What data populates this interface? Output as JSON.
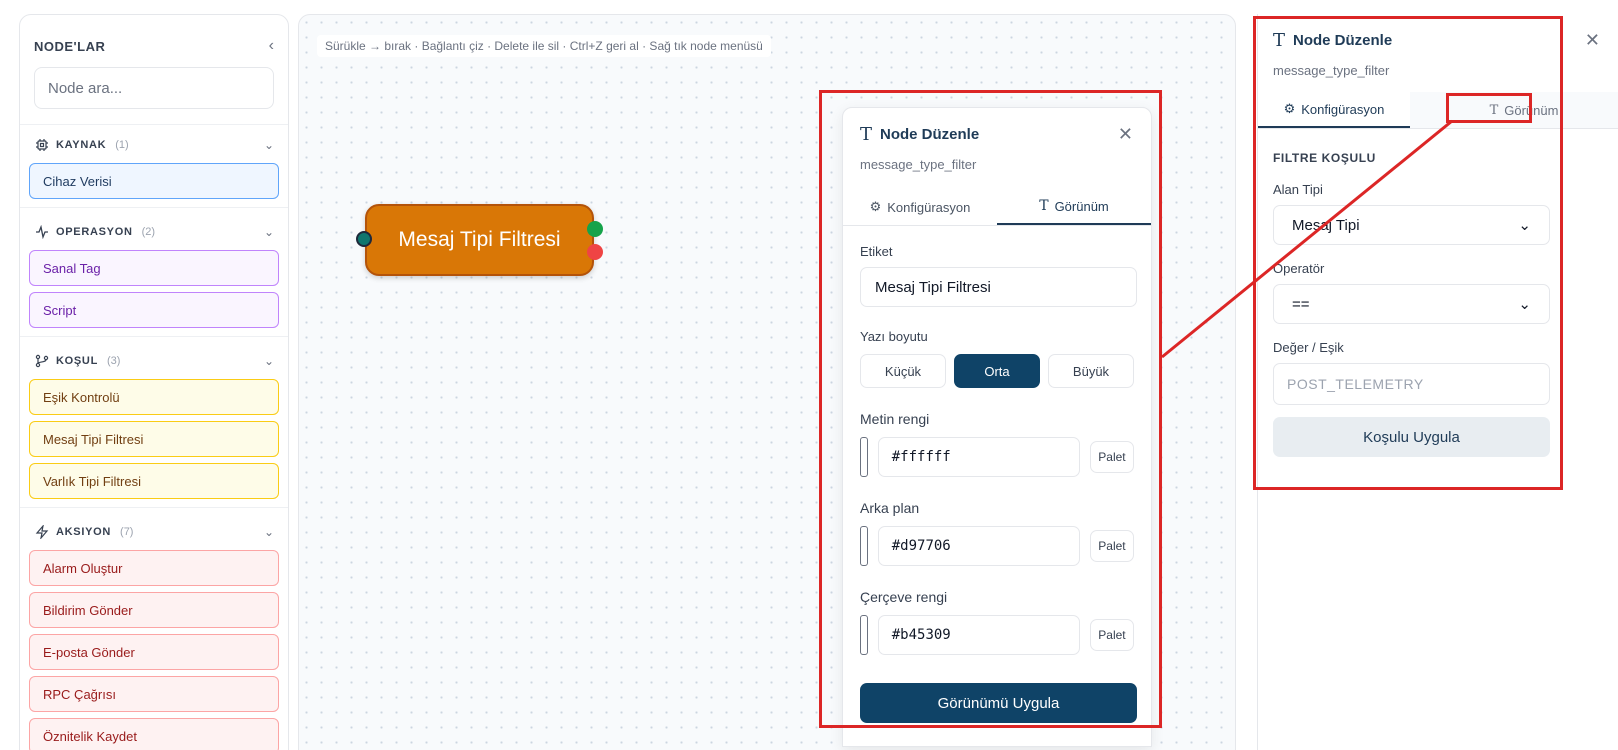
{
  "sidebar": {
    "title": "NODE'LAR",
    "search_placeholder": "Node ara...",
    "categories": [
      {
        "name": "KAYNAK",
        "count": "(1)",
        "items": [
          "Cihaz Verisi"
        ]
      },
      {
        "name": "OPERASYON",
        "count": "(2)",
        "items": [
          "Sanal Tag",
          "Script"
        ]
      },
      {
        "name": "KOŞUL",
        "count": "(3)",
        "items": [
          "Eşik Kontrolü",
          "Mesaj Tipi Filtresi",
          "Varlık Tipi Filtresi"
        ]
      },
      {
        "name": "AKSIYON",
        "count": "(7)",
        "items": [
          "Alarm Oluştur",
          "Bildirim Gönder",
          "E-posta Gönder",
          "RPC Çağrısı",
          "Öznitelik Kaydet"
        ]
      }
    ]
  },
  "canvas": {
    "hint": "Sürükle → bırak · Bağlantı çiz · Delete ile sil · Ctrl+Z geri al · Sağ tık node menüsü",
    "node_label": "Mesaj Tipi Filtresi"
  },
  "popup": {
    "title": "Node Düzenle",
    "subtitle": "message_type_filter",
    "tabs": [
      "Konfigürasyon",
      "Görünüm"
    ],
    "label_label": "Etiket",
    "label_value": "Mesaj Tipi Filtresi",
    "fontsize_label": "Yazı boyutu",
    "fontsize_options": [
      "Küçük",
      "Orta",
      "Büyük"
    ],
    "text_color_label": "Metin rengi",
    "text_color_value": "#ffffff",
    "bg_label": "Arka plan",
    "bg_value": "#d97706",
    "border_label": "Çerçeve rengi",
    "border_value": "#b45309",
    "palette_label": "Palet",
    "apply_label": "Görünümü Uygula"
  },
  "rpanel": {
    "title": "Node Düzenle",
    "subtitle": "message_type_filter",
    "tabs": [
      "Konfigürasyon",
      "Görünüm"
    ],
    "section": "FILTRE KOŞULU",
    "field_type_label": "Alan Tipi",
    "field_type_value": "Mesaj Tipi",
    "operator_label": "Operatör",
    "operator_value": "==",
    "value_label": "Değer / Eşik",
    "value_placeholder": "POST_TELEMETRY",
    "apply_label": "Koşulu Uygula"
  },
  "colors": {
    "node_bg": "#d97706",
    "node_border": "#b45309",
    "primary": "#0f4367",
    "annotation": "#dc2626"
  }
}
